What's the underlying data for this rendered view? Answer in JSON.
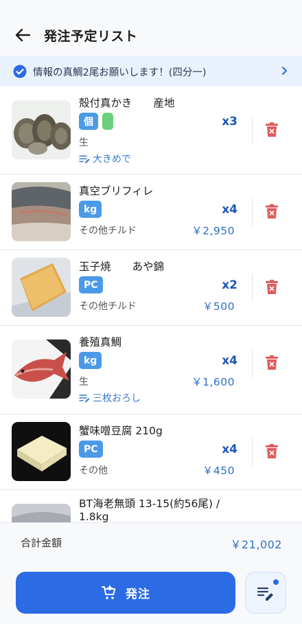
{
  "header": {
    "title": "発注予定リスト"
  },
  "notice": {
    "text": "情報の真鯛2尾お願いします！(四分一)"
  },
  "items": [
    {
      "name": "殻付真かき　　産地",
      "tag": "個",
      "category": "生",
      "price": "",
      "qty": "x3",
      "note": "大きめで"
    },
    {
      "name": "真空ブリフィレ",
      "tag": "kg",
      "category": "その他チルド",
      "price": "￥2,950",
      "qty": "x4",
      "note": ""
    },
    {
      "name": "玉子焼　　あや錦",
      "tag": "PC",
      "category": "その他チルド",
      "price": "￥500",
      "qty": "x2",
      "note": ""
    },
    {
      "name": "養殖真鯛",
      "tag": "kg",
      "category": "生",
      "price": "￥1,600",
      "qty": "x4",
      "note": "三枚おろし"
    },
    {
      "name": "蟹味噌豆腐 210g",
      "tag": "PC",
      "category": "その他",
      "price": "￥450",
      "qty": "x4",
      "note": ""
    },
    {
      "name": "BT海老無頭 13-15(約56尾) /",
      "name2": "1.8kg"
    }
  ],
  "footer": {
    "total_label": "合計金額",
    "total_value": "￥21,002",
    "order_label": "発注"
  },
  "colors": {
    "accent": "#2b6be4",
    "tag": "#4a9ae8",
    "trash": "#e05c5c"
  }
}
